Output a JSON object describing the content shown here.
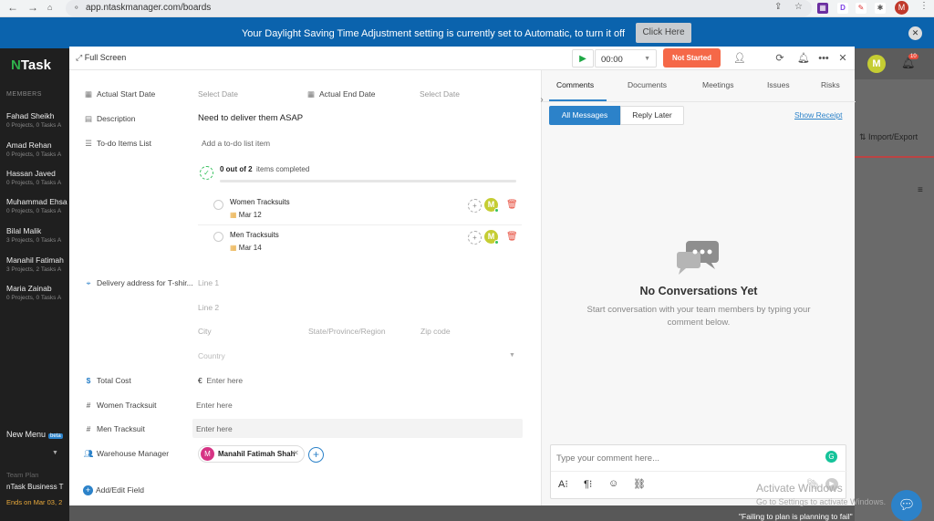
{
  "browser": {
    "url": "app.ntaskmanager.com/boards",
    "profile": "M"
  },
  "banner": {
    "message": "Your Daylight Saving Time Adjustment setting is currently set to Automatic, to turn it off",
    "button": "Click Here"
  },
  "app": {
    "logo_prefix": "N",
    "logo_text": "Task",
    "members_heading": "MEMBERS",
    "members": [
      {
        "name": "Fahad Sheikh",
        "stats": "0 Projects, 0 Tasks A"
      },
      {
        "name": "Amad Rehan",
        "stats": "0 Projects, 0 Tasks A"
      },
      {
        "name": "Hassan Javed",
        "stats": "0 Projects, 0 Tasks A"
      },
      {
        "name": "Muhammad Ehsa",
        "stats": "0 Projects, 0 Tasks A"
      },
      {
        "name": "Bilal Malik",
        "stats": "3 Projects, 0 Tasks A"
      },
      {
        "name": "Manahil Fatimah",
        "stats": "3 Projects, 2 Tasks A"
      },
      {
        "name": "Maria Zainab",
        "stats": "0 Projects, 0 Tasks A"
      }
    ],
    "new_menu": "New Menu",
    "beta": "beta",
    "trial": "Team Plan",
    "business": "nTask Business T",
    "ends": "Ends on Mar 03, 2",
    "import_export": "Import/Export",
    "notif_count": "10",
    "user_initial": "M"
  },
  "modal": {
    "full_screen": "Full Screen",
    "timer": "00:00",
    "status": "Not Started",
    "fields": {
      "actual_start_label": "Actual Start Date",
      "actual_start_value": "Select Date",
      "actual_end_label": "Actual End Date",
      "actual_end_value": "Select Date",
      "description_label": "Description",
      "description_value": "Need to deliver them ASAP",
      "todo_label": "To-do Items List",
      "todo_placeholder": "Add a to-do list item",
      "progress_count": "0 out of 2",
      "progress_text": "items completed",
      "todos": [
        {
          "title": "Women Tracksuits",
          "date": "Mar 12",
          "assignee": "M"
        },
        {
          "title": "Men Tracksuits",
          "date": "Mar 14",
          "assignee": "M"
        }
      ],
      "delivery_label": "Delivery address for T-shir...",
      "line1": "Line 1",
      "line2": "Line 2",
      "city": "City",
      "state": "State/Province/Region",
      "zip": "Zip code",
      "country": "Country",
      "total_cost_label": "Total Cost",
      "currency": "€",
      "total_cost_placeholder": "Enter here",
      "women_label": "Women Tracksuit",
      "women_placeholder": "Enter here",
      "men_label": "Men Tracksuit",
      "men_placeholder": "Enter here",
      "warehouse_label": "Warehouse Manager",
      "warehouse_user": "Manahil Fatimah Shah",
      "warehouse_initial": "M",
      "add_edit": "Add/Edit Field"
    },
    "comments": {
      "tabs": [
        "Comments",
        "Documents",
        "Meetings",
        "Issues",
        "Risks"
      ],
      "all_messages": "All Messages",
      "reply_later": "Reply Later",
      "show_receipt": "Show Receipt",
      "empty_title": "No Conversations Yet",
      "empty_desc": "Start conversation with your team members by typing your comment below.",
      "input_placeholder": "Type your comment here..."
    }
  },
  "overlay": {
    "activate": "Activate Windows",
    "activate_sub": "Go to Settings to activate Windows.",
    "quote": "\"Failing to plan is planning to fail\""
  },
  "colors": {
    "accent": "#2c82c9",
    "status": "#f56848",
    "banner": "#0b63ad",
    "avatar": "#c5cd33"
  }
}
